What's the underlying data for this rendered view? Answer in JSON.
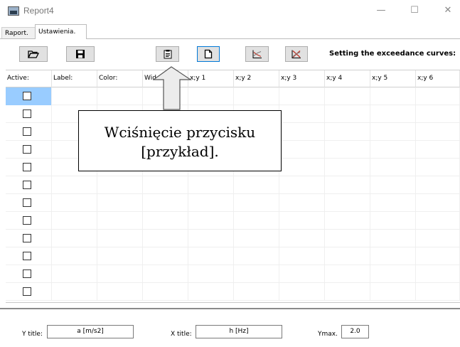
{
  "window": {
    "title": "Report4",
    "minimize_glyph": "—",
    "maximize_glyph": "☐",
    "close_glyph": "✕"
  },
  "tabs": [
    {
      "label": "Raport.",
      "active": false
    },
    {
      "label": "Ustawienia.",
      "active": true
    }
  ],
  "toolbar": {
    "buttons": [
      {
        "icon": "folder-open-icon"
      },
      {
        "icon": "floppy-save-icon"
      },
      {
        "icon": "paste-example-icon"
      },
      {
        "icon": "new-page-icon"
      },
      {
        "icon": "curve-chart-icon"
      },
      {
        "icon": "delete-curve-icon"
      }
    ],
    "label": "Setting the exceedance curves:"
  },
  "grid": {
    "columns": [
      "Active:",
      "Label:",
      "Color:",
      "Wid",
      "x;y 1",
      "x;y 2",
      "x;y 3",
      "x;y 4",
      "x;y 5",
      "x;y 6"
    ],
    "row_count": 12,
    "selected_row": 0
  },
  "callout": {
    "line1": "Wciśnięcie przycisku",
    "line2": "[przykład]."
  },
  "footer": {
    "y_title_label": "Y title:",
    "y_title_value": "a [m/s2]",
    "x_title_label": "X title:",
    "x_title_value": "h [Hz]",
    "ymax_label": "Ymax.",
    "ymax_value": "2.0"
  },
  "colors": {
    "selected_cell": "#99ccff",
    "focus_border": "#0078d7",
    "button_face": "#e1e1e1"
  }
}
